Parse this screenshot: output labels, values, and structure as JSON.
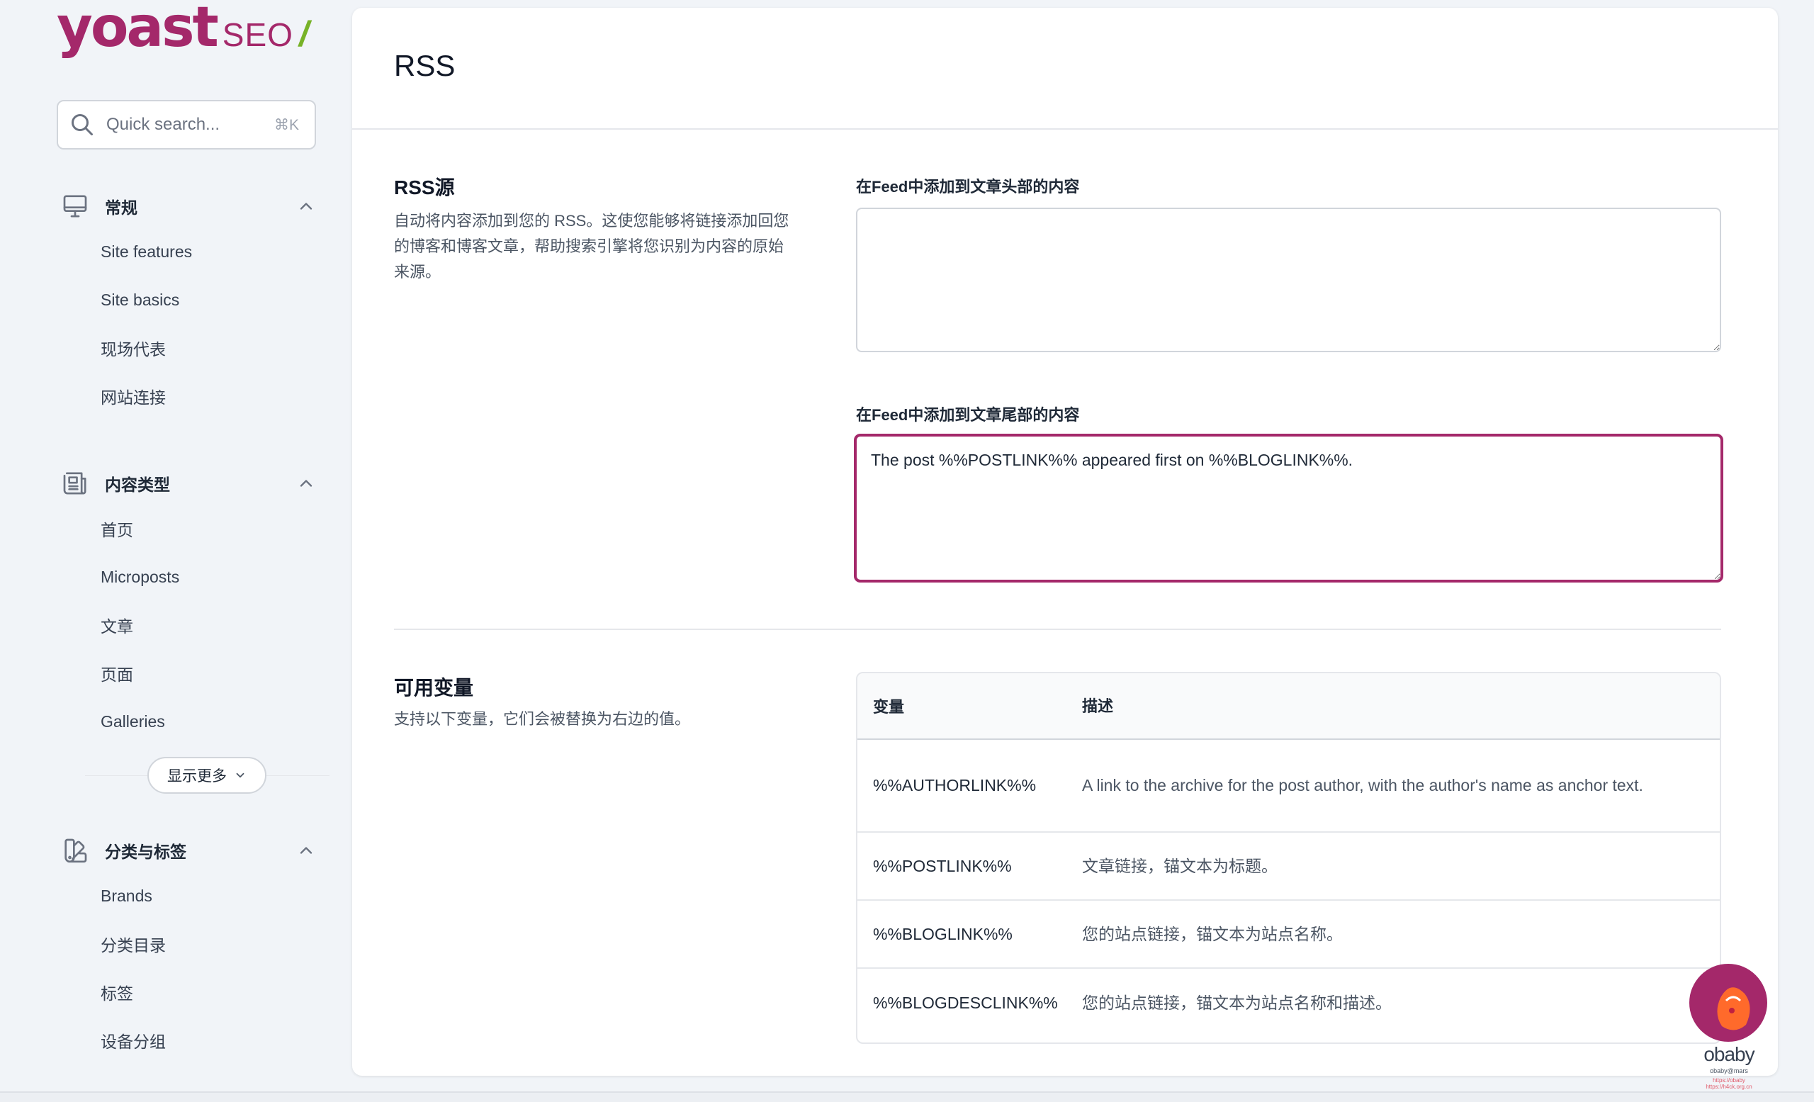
{
  "logo": {
    "word": "yoast",
    "seo": "SEO",
    "slash": "/"
  },
  "search": {
    "placeholder": "Quick search...",
    "shortcut": "⌘K"
  },
  "sidebar": {
    "groups": [
      {
        "label": "常规",
        "icon": "desktop-icon",
        "items": [
          "Site features",
          "Site basics",
          "现场代表",
          "网站连接"
        ]
      },
      {
        "label": "内容类型",
        "icon": "newspaper-icon",
        "items": [
          "首页",
          "Microposts",
          "文章",
          "页面",
          "Galleries"
        ]
      },
      {
        "label": "分类与标签",
        "icon": "color-swatch-icon",
        "items": [
          "Brands",
          "分类目录",
          "标签",
          "设备分组"
        ]
      }
    ],
    "show_more": "显示更多"
  },
  "page": {
    "title": "RSS",
    "rss_section": {
      "title": "RSS源",
      "description": "自动将内容添加到您的 RSS。这使您能够将链接添加回您的博客和博客文章，帮助搜索引擎将您识别为内容的原始来源。",
      "before_label": "在Feed中添加到文章头部的内容",
      "before_value": "",
      "after_label": "在Feed中添加到文章尾部的内容",
      "after_value": "The post %%POSTLINK%% appeared first on %%BLOGLINK%%."
    },
    "vars_section": {
      "title": "可用变量",
      "description": "支持以下变量，它们会被替换为右边的值。",
      "col_variable": "变量",
      "col_description": "描述",
      "rows": [
        {
          "variable": "%%AUTHORLINK%%",
          "description": "A link to the archive for the post author, with the author's name as anchor text."
        },
        {
          "variable": "%%POSTLINK%%",
          "description": "文章链接，锚文本为标题。"
        },
        {
          "variable": "%%BLOGLINK%%",
          "description": "您的站点链接，锚文本为站点名称。"
        },
        {
          "variable": "%%BLOGDESCLINK%%",
          "description": "您的站点链接，锚文本为站点名称和描述。"
        }
      ]
    }
  },
  "badge": {
    "name": "obaby",
    "sub": "obaby@mars",
    "url1": "https://obaby",
    "url2": "https://h4ck.org.cn"
  },
  "colors": {
    "brand": "#a4286a",
    "accent_green": "#77b227",
    "bg": "#f1f4f8",
    "text_muted": "#4b5563"
  }
}
